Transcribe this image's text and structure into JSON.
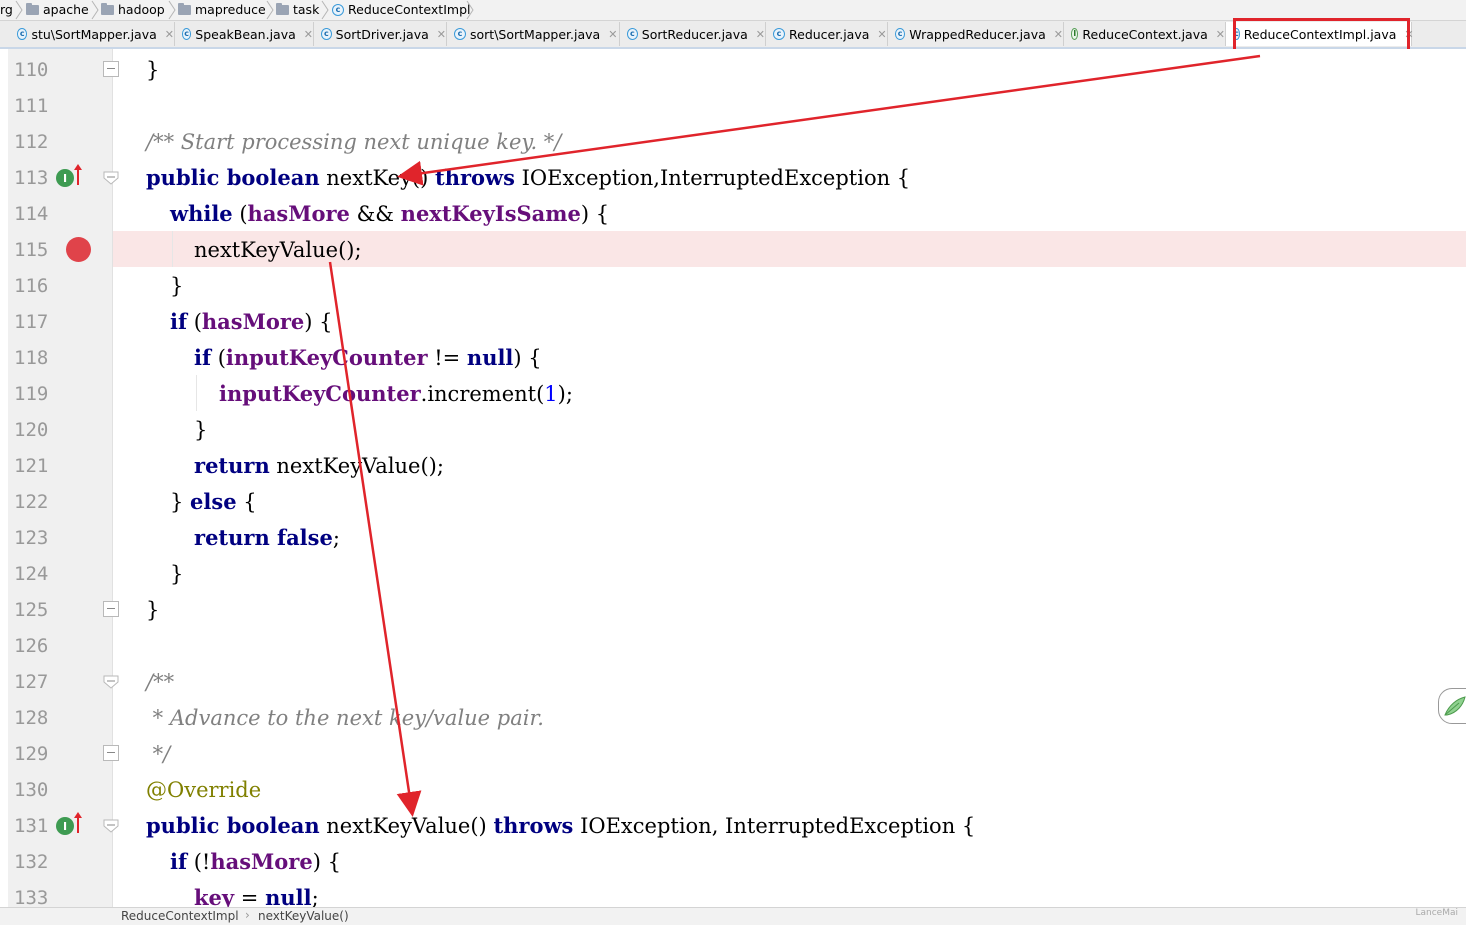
{
  "breadcrumb": {
    "items": [
      {
        "label": "rg",
        "icon": "none"
      },
      {
        "label": "apache",
        "icon": "folder-icon"
      },
      {
        "label": "hadoop",
        "icon": "folder-icon"
      },
      {
        "label": "mapreduce",
        "icon": "folder-icon"
      },
      {
        "label": "task",
        "icon": "folder-icon"
      },
      {
        "label": "ReduceContextImpl",
        "icon": "class-icon"
      }
    ]
  },
  "tabs": [
    {
      "label": "stu\\SortMapper.java",
      "icon": "class-icon"
    },
    {
      "label": "SpeakBean.java",
      "icon": "class-icon"
    },
    {
      "label": "SortDriver.java",
      "icon": "class-icon"
    },
    {
      "label": "sort\\SortMapper.java",
      "icon": "class-icon"
    },
    {
      "label": "SortReducer.java",
      "icon": "class-icon"
    },
    {
      "label": "Reducer.java",
      "icon": "class-icon"
    },
    {
      "label": "WrappedReducer.java",
      "icon": "class-icon"
    },
    {
      "label": "ReduceContext.java",
      "icon": "interface-icon"
    },
    {
      "label": "ReduceContextImpl.java",
      "icon": "class-icon",
      "active": true
    }
  ],
  "editor": {
    "line_numbers": [
      "110",
      "111",
      "112",
      "113",
      "114",
      "115",
      "116",
      "117",
      "118",
      "119",
      "120",
      "121",
      "122",
      "123",
      "124",
      "125",
      "126",
      "127",
      "128",
      "129",
      "130",
      "131",
      "132",
      "133"
    ],
    "breakpoint_line": "115",
    "tokens": {
      "l110_a": "}",
      "l112_a": "/** Start processing next unique key. */",
      "l113_a": "public boolean",
      "l113_b": " nextKey() ",
      "l113_c": "throws",
      "l113_d": " IOException,InterruptedException {",
      "l114_a": "while",
      "l114_b": " (",
      "l114_c": "hasMore",
      "l114_d": " && ",
      "l114_e": "nextKeyIsSame",
      "l114_f": ") {",
      "l115_a": "nextKeyValue();",
      "l116_a": "}",
      "l117_a": "if",
      "l117_b": " (",
      "l117_c": "hasMore",
      "l117_d": ") {",
      "l118_a": "if",
      "l118_b": " (",
      "l118_c": "inputKeyCounter",
      "l118_d": " != ",
      "l118_e": "null",
      "l118_f": ") {",
      "l119_a": "inputKeyCounter",
      "l119_b": ".increment(",
      "l119_c": "1",
      "l119_d": ");",
      "l120_a": "}",
      "l121_a": "return",
      "l121_b": " nextKeyValue();",
      "l122_a": "} ",
      "l122_b": "else",
      "l122_c": " {",
      "l123_a": "return false",
      "l123_b": ";",
      "l124_a": "}",
      "l125_a": "}",
      "l127_a": "/**",
      "l128_a": " * Advance to the next key/value pair.",
      "l129_a": " */",
      "l130_a": "@Override",
      "l131_a": "public boolean",
      "l131_b": " nextKeyValue() ",
      "l131_c": "throws",
      "l131_d": " IOException, InterruptedException {",
      "l132_a": "if",
      "l132_b": " (!",
      "l132_c": "hasMore",
      "l132_d": ") {",
      "l133_a": "key",
      "l133_b": " = ",
      "l133_c": "null",
      "l133_d": ";"
    }
  },
  "gutter_icons": {
    "implements_badge": "I"
  },
  "status_bar": {
    "path": [
      "ReduceContextImpl",
      "nextKeyValue()"
    ],
    "watermark": "LanceMai"
  },
  "colors": {
    "annotation_red": "#e0242b",
    "keyword": "#000080",
    "field": "#660e7a",
    "comment": "#808080",
    "annotation": "#808000",
    "number": "#0000ff",
    "breakpoint": "#e0434a",
    "breakpoint_line_bg": "#fae6e6"
  }
}
